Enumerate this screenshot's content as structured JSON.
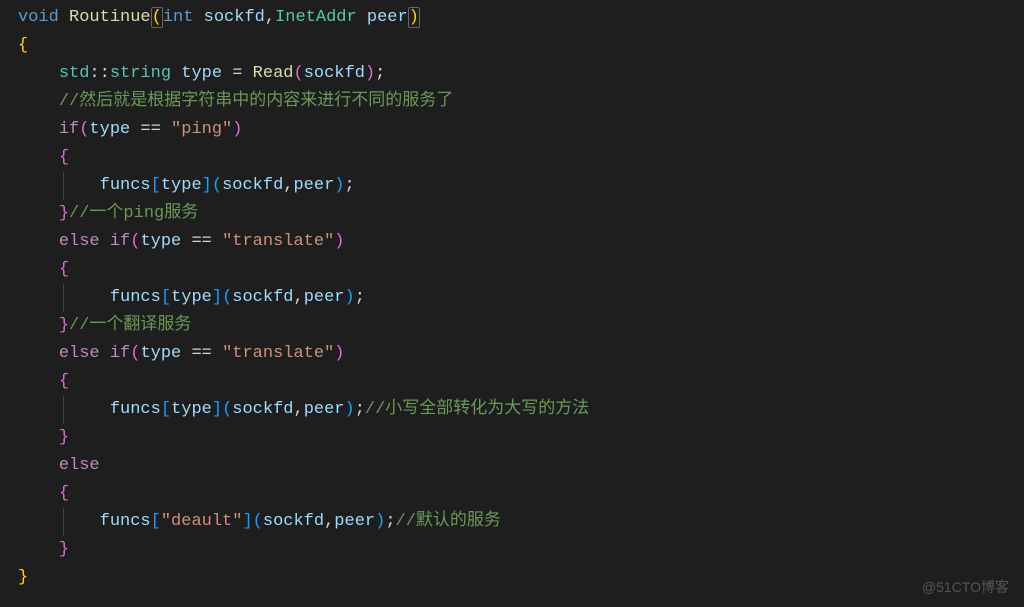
{
  "code": {
    "sig_void": "void",
    "sig_fn": "Routinue",
    "sig_lparen": "(",
    "sig_int": "int",
    "sig_space": " ",
    "sig_p1": "sockfd",
    "sig_comma": ",",
    "sig_type2": "InetAddr",
    "sig_p2": "peer",
    "sig_rparen": ")",
    "obrace": "{",
    "cbrace": "}",
    "ns": "std",
    "scope": "::",
    "stringT": "string",
    "type_var": "type",
    "assign": " = ",
    "readfn": "Read",
    "lp": "(",
    "rp": ")",
    "semi": ";",
    "comment1": "//然后就是根据字符串中的内容来进行不同的服务了",
    "if": "if",
    "eqeq": " == ",
    "str_ping": "\"ping\"",
    "funcs": "funcs",
    "lbrk": "[",
    "rbrk": "]",
    "peer": "peer",
    "sockfd": "sockfd",
    "comma": ",",
    "comment_ping": "//一个ping服务",
    "else": "else",
    "str_translate": "\"translate\"",
    "comment_translate": "//一个翻译服务",
    "comment_upper": "//小写全部转化为大写的方法",
    "str_deault": "\"deault\"",
    "comment_default": "//默认的服务"
  },
  "watermark": "@51CTO博客"
}
